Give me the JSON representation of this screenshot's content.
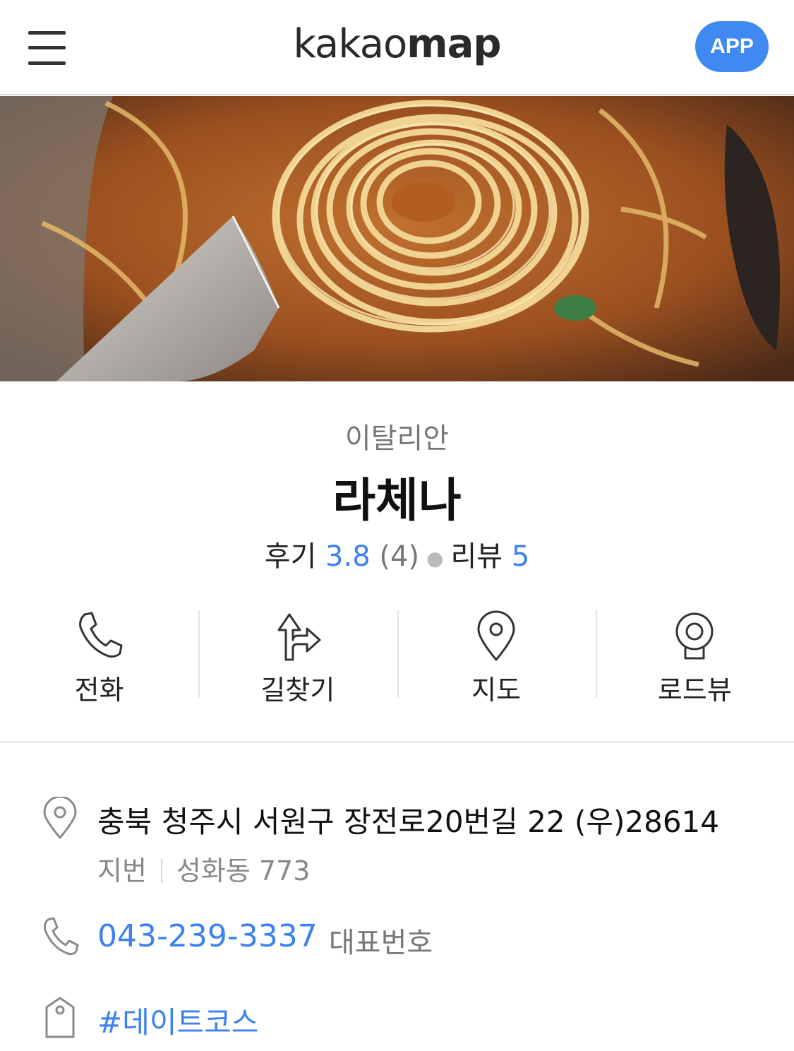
{
  "header": {
    "brand_light": "kakao",
    "brand_bold": "map",
    "app_button": "APP"
  },
  "place": {
    "category": "이탈리안",
    "name": "라체나",
    "review_label": "후기",
    "review_score": "3.8",
    "review_count": "(4)",
    "blog_label": "리뷰",
    "blog_count": "5"
  },
  "actions": [
    {
      "label": "전화",
      "icon": "phone-icon"
    },
    {
      "label": "길찾기",
      "icon": "directions-icon"
    },
    {
      "label": "지도",
      "icon": "map-pin-icon"
    },
    {
      "label": "로드뷰",
      "icon": "roadview-icon"
    }
  ],
  "info": {
    "address": "충북 청주시 서원구 장전로20번길 22 (우)28614",
    "lot_label": "지번",
    "lot_address": "성화동 773",
    "phone": "043-239-3337",
    "phone_tag": "대표번호",
    "hashtag": "#데이트코스"
  },
  "colors": {
    "accent": "#3b82f0",
    "app_button": "#3f89f0"
  }
}
